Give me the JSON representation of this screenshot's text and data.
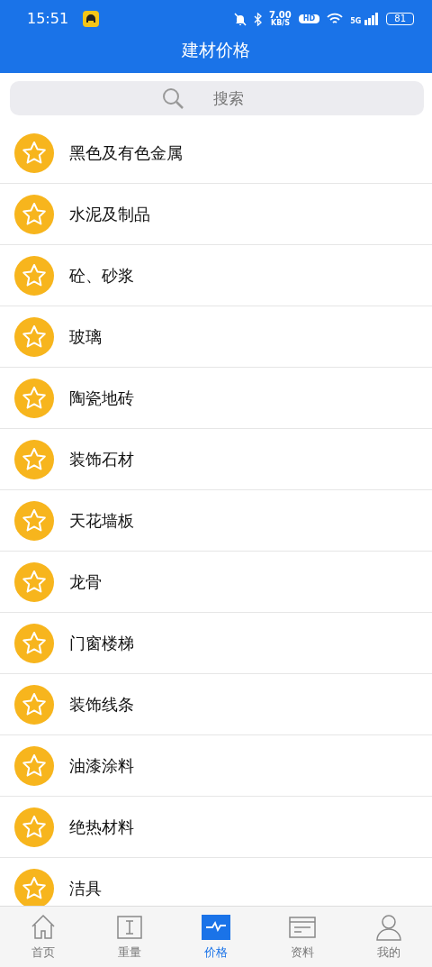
{
  "status_bar": {
    "time": "15:51",
    "speed": "7.00",
    "speed_unit": "KB/S",
    "hd": "HD",
    "network": "5G",
    "battery": "81"
  },
  "header": {
    "title": "建材价格"
  },
  "search": {
    "placeholder": "搜索"
  },
  "categories": [
    {
      "label": "黑色及有色金属"
    },
    {
      "label": "水泥及制品"
    },
    {
      "label": "砼、砂浆"
    },
    {
      "label": "玻璃"
    },
    {
      "label": "陶瓷地砖"
    },
    {
      "label": "装饰石材"
    },
    {
      "label": "天花墙板"
    },
    {
      "label": "龙骨"
    },
    {
      "label": "门窗楼梯"
    },
    {
      "label": "装饰线条"
    },
    {
      "label": "油漆涂料"
    },
    {
      "label": "绝热材料"
    },
    {
      "label": "洁具"
    }
  ],
  "tab_bar": [
    {
      "label": "首页",
      "kind": "home",
      "selected": false
    },
    {
      "label": "重量",
      "kind": "weight",
      "selected": false
    },
    {
      "label": "价格",
      "kind": "price",
      "selected": true
    },
    {
      "label": "资料",
      "kind": "docs",
      "selected": false
    },
    {
      "label": "我的",
      "kind": "profile",
      "selected": false
    }
  ]
}
